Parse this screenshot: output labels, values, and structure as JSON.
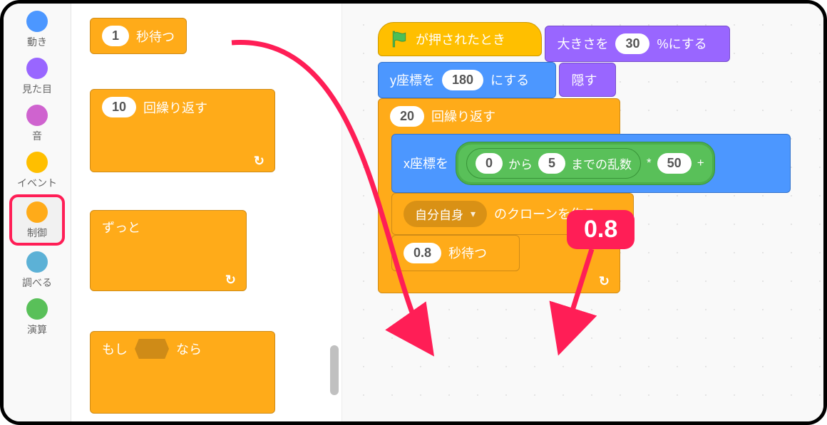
{
  "sidebar": {
    "motion": "動き",
    "looks": "見た目",
    "sound": "音",
    "events": "イベント",
    "control": "制御",
    "sensing": "調べる",
    "operators": "演算"
  },
  "palette": {
    "wait": {
      "value": "1",
      "label": "秒待つ"
    },
    "repeat": {
      "value": "10",
      "label": "回繰り返す"
    },
    "forever": {
      "label": "ずっと"
    },
    "if": {
      "pre": "もし",
      "post": "なら"
    }
  },
  "script": {
    "whenFlag": "が押されたとき",
    "setSize": {
      "pre": "大きさを",
      "value": "30",
      "post": "%にする"
    },
    "setY": {
      "pre": "y座標を",
      "value": "180",
      "post": "にする"
    },
    "hide": "隠す",
    "repeat": {
      "value": "20",
      "label": "回繰り返す"
    },
    "setX": {
      "pre": "x座標を",
      "randFrom": "0",
      "randMid1": "から",
      "randTo": "5",
      "randMid2": "までの乱数",
      "times": "*",
      "mult": "50",
      "plus": "+"
    },
    "clone": {
      "target": "自分自身",
      "label": "のクローンを作る"
    },
    "wait": {
      "value": "0.8",
      "label": "秒待つ"
    }
  },
  "annotation": {
    "value": "0.8"
  }
}
